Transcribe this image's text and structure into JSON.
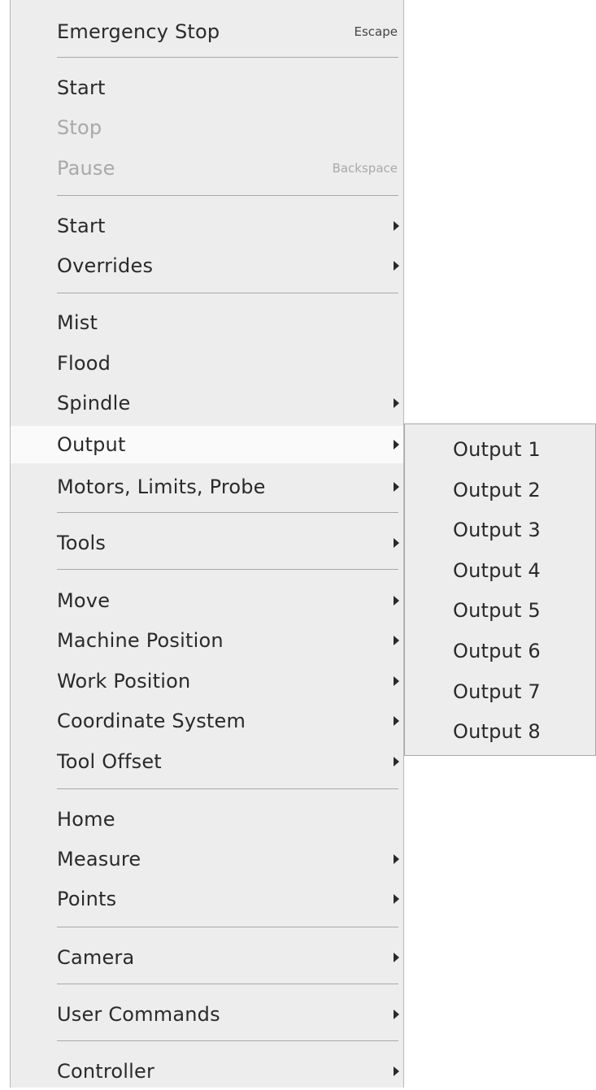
{
  "menu": {
    "emergency_stop": {
      "label": "Emergency Stop",
      "shortcut": "Escape"
    },
    "start": {
      "label": "Start"
    },
    "stop": {
      "label": "Stop"
    },
    "pause": {
      "label": "Pause",
      "shortcut": "Backspace"
    },
    "start_sub": {
      "label": "Start"
    },
    "overrides": {
      "label": "Overrides"
    },
    "mist": {
      "label": "Mist"
    },
    "flood": {
      "label": "Flood"
    },
    "spindle": {
      "label": "Spindle"
    },
    "output": {
      "label": "Output"
    },
    "motors": {
      "label": "Motors, Limits, Probe"
    },
    "tools": {
      "label": "Tools"
    },
    "move": {
      "label": "Move"
    },
    "machine_position": {
      "label": "Machine Position"
    },
    "work_position": {
      "label": "Work Position"
    },
    "coordinate_system": {
      "label": "Coordinate System"
    },
    "tool_offset": {
      "label": "Tool Offset"
    },
    "home": {
      "label": "Home"
    },
    "measure": {
      "label": "Measure"
    },
    "points": {
      "label": "Points"
    },
    "camera": {
      "label": "Camera"
    },
    "user_commands": {
      "label": "User Commands"
    },
    "controller": {
      "label": "Controller"
    }
  },
  "submenu": {
    "items": [
      "Output 1",
      "Output 2",
      "Output 3",
      "Output 4",
      "Output 5",
      "Output 6",
      "Output 7",
      "Output 8"
    ]
  },
  "colors": {
    "menu_bg": "#ededed",
    "highlight_bg": "#fafafa",
    "text": "#2a2a2a",
    "disabled_text": "#a9a9a9",
    "separator": "#a8a8a8"
  }
}
